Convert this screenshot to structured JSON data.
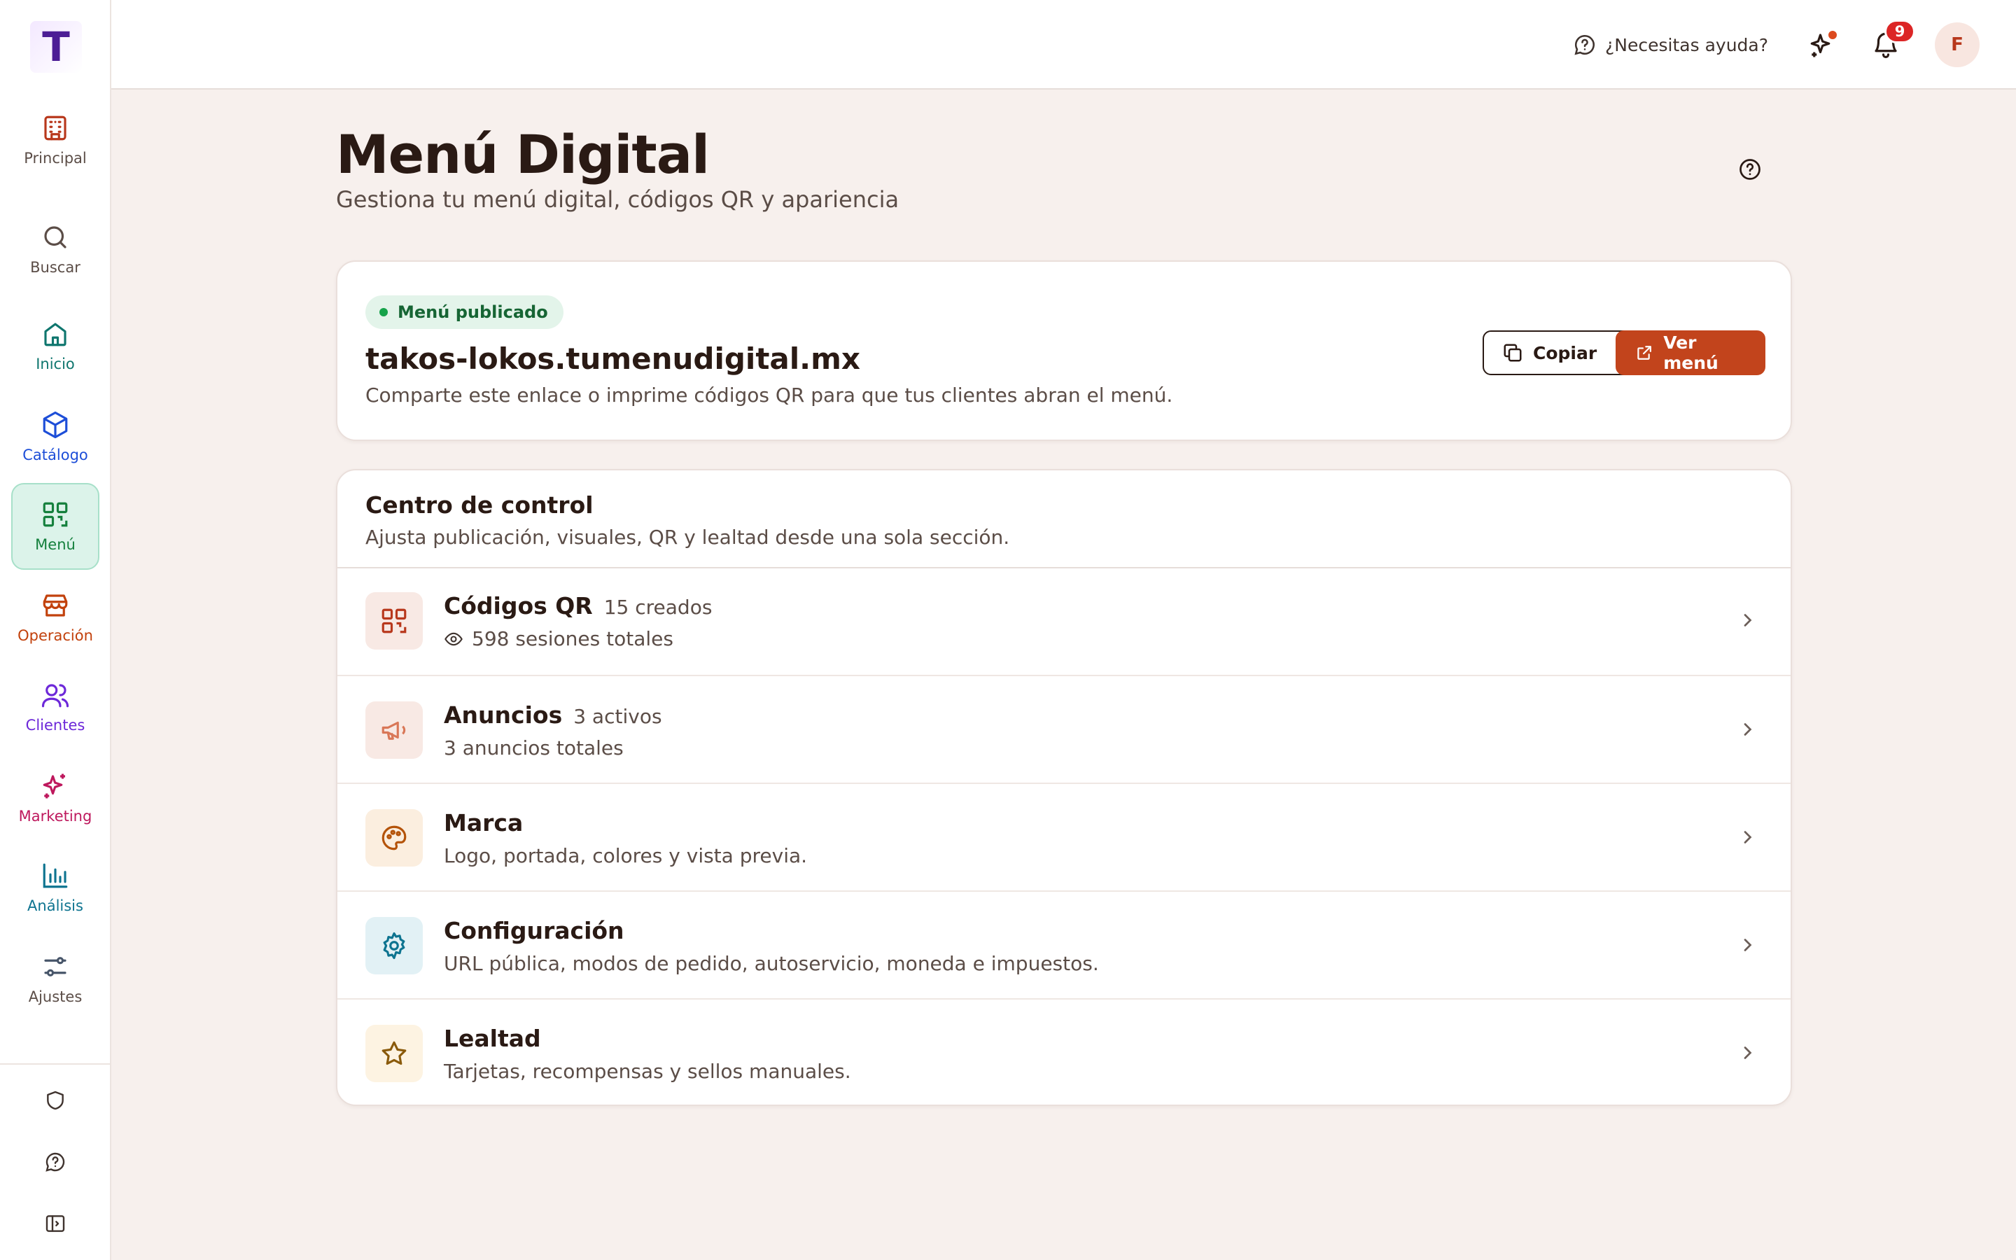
{
  "brand": {
    "logo_letter": "T"
  },
  "sidebar": {
    "items": [
      {
        "label": "Principal",
        "icon": "building-icon",
        "color": "#b8381c"
      },
      {
        "label": "Buscar",
        "icon": "search-icon",
        "color": "#5b4d47"
      },
      {
        "label": "Inicio",
        "icon": "home-icon",
        "color": "#0f766e"
      },
      {
        "label": "Catálogo",
        "icon": "box-icon",
        "color": "#1d4ed8"
      },
      {
        "label": "Menú",
        "icon": "qr-code-icon",
        "color": "#15803d",
        "active": true
      },
      {
        "label": "Operación",
        "icon": "store-icon",
        "color": "#c2410c"
      },
      {
        "label": "Clientes",
        "icon": "users-icon",
        "color": "#6d28d9"
      },
      {
        "label": "Marketing",
        "icon": "sparkles-icon",
        "color": "#be185d"
      },
      {
        "label": "Análisis",
        "icon": "bar-chart-icon",
        "color": "#0e7490"
      },
      {
        "label": "Ajustes",
        "icon": "sliders-icon",
        "color": "#475569"
      }
    ],
    "bottom": [
      "shield-icon",
      "help-chat-icon",
      "collapse-sidebar-icon"
    ]
  },
  "topbar": {
    "help_label": "¿Necesitas ayuda?",
    "notifications_count": "9",
    "avatar_initial": "F"
  },
  "page": {
    "title": "Menú Digital",
    "subtitle": "Gestiona tu menú digital, códigos QR y apariencia"
  },
  "publish": {
    "status": "Menú publicado",
    "url": "takos-lokos.tumenudigital.mx",
    "description": "Comparte este enlace o imprime códigos QR para que tus clientes abran el menú.",
    "copy_label": "Copiar",
    "view_label": "Ver menú"
  },
  "control": {
    "title": "Centro de control",
    "subtitle": "Ajusta publicación, visuales, QR y lealtad desde una sola sección.",
    "rows": [
      {
        "title": "Códigos QR",
        "meta": "15 creados",
        "sub": "598 sesiones totales",
        "icon": "qr-code-icon",
        "bg": "#f8e9e4",
        "color": "#b8381c"
      },
      {
        "title": "Anuncios",
        "meta": "3 activos",
        "sub": "3 anuncios totales",
        "icon": "megaphone-icon",
        "bg": "#f8e9e4",
        "color": "#d97757"
      },
      {
        "title": "Marca",
        "meta": "",
        "sub": "Logo, portada, colores y vista previa.",
        "icon": "palette-icon",
        "bg": "#fbeedf",
        "color": "#b45309"
      },
      {
        "title": "Configuración",
        "meta": "",
        "sub": "URL pública, modos de pedido, autoservicio, moneda e impuestos.",
        "icon": "gear-icon",
        "bg": "#e2f1f5",
        "color": "#0e7490"
      },
      {
        "title": "Lealtad",
        "meta": "",
        "sub": "Tarjetas, recompensas y sellos manuales.",
        "icon": "star-icon",
        "bg": "#fdf3e2",
        "color": "#8a5a0b"
      }
    ]
  }
}
